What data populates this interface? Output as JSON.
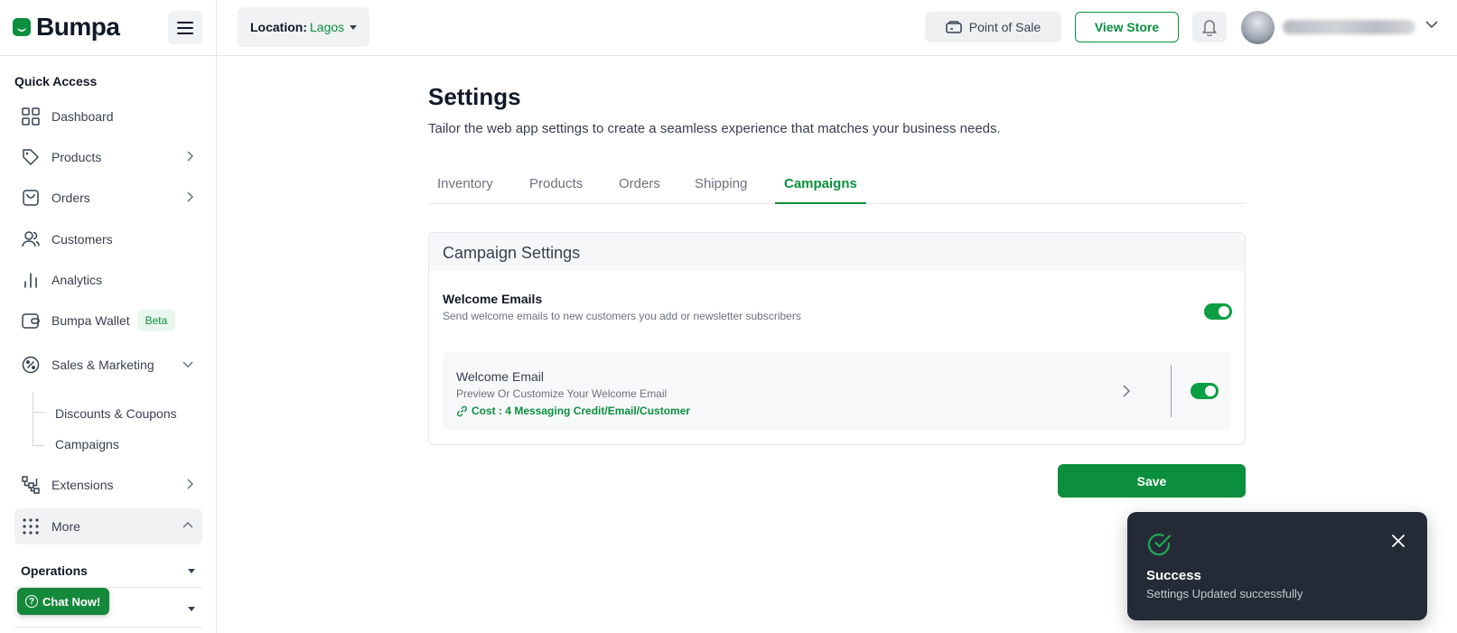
{
  "brand": {
    "name": "Bumpa",
    "color": "#0b8f3e"
  },
  "header": {
    "location_label": "Location:",
    "location_value": "Lagos",
    "pos_label": "Point of Sale",
    "view_store_label": "View Store",
    "icons": [
      "menu-icon",
      "store-icon",
      "bell-icon",
      "chevron-down-icon"
    ]
  },
  "sidebar": {
    "section_title": "Quick Access",
    "items": [
      {
        "label": "Dashboard",
        "icon": "grid-icon"
      },
      {
        "label": "Products",
        "icon": "tag-icon"
      },
      {
        "label": "Orders",
        "icon": "bag-icon"
      },
      {
        "label": "Customers",
        "icon": "users-icon"
      },
      {
        "label": "Analytics",
        "icon": "bar-chart-icon"
      },
      {
        "label": "Bumpa Wallet",
        "icon": "wallet-icon",
        "badge": "Beta"
      },
      {
        "label": "Sales & Marketing",
        "icon": "percent-icon"
      },
      {
        "label": "Extensions",
        "icon": "extensions-icon"
      },
      {
        "label": "More",
        "icon": "dots-grid-icon"
      }
    ],
    "sub_items": [
      "Discounts & Coupons",
      "Campaigns"
    ],
    "operations_label": "Operations",
    "chat_label": "Chat Now!"
  },
  "main": {
    "title": "Settings",
    "subtitle": "Tailor the web app settings to create a seamless experience that matches your business needs.",
    "tabs": [
      {
        "label": "Inventory",
        "active": false
      },
      {
        "label": "Products",
        "active": false
      },
      {
        "label": "Orders",
        "active": false
      },
      {
        "label": "Shipping",
        "active": false
      },
      {
        "label": "Campaigns",
        "active": true
      }
    ],
    "card": {
      "title": "Campaign Settings",
      "welcome_emails_title": "Welcome Emails",
      "welcome_emails_desc": "Send welcome emails to new customers you add or newsletter subscribers",
      "welcome_emails_enabled": true,
      "welcome_email": {
        "title": "Welcome Email",
        "desc": "Preview Or Customize Your Welcome Email",
        "cost": "Cost : 4 Messaging Credit/Email/Customer",
        "enabled": true
      }
    },
    "save_label": "Save"
  },
  "toast": {
    "title": "Success",
    "message": "Settings Updated successfully"
  }
}
